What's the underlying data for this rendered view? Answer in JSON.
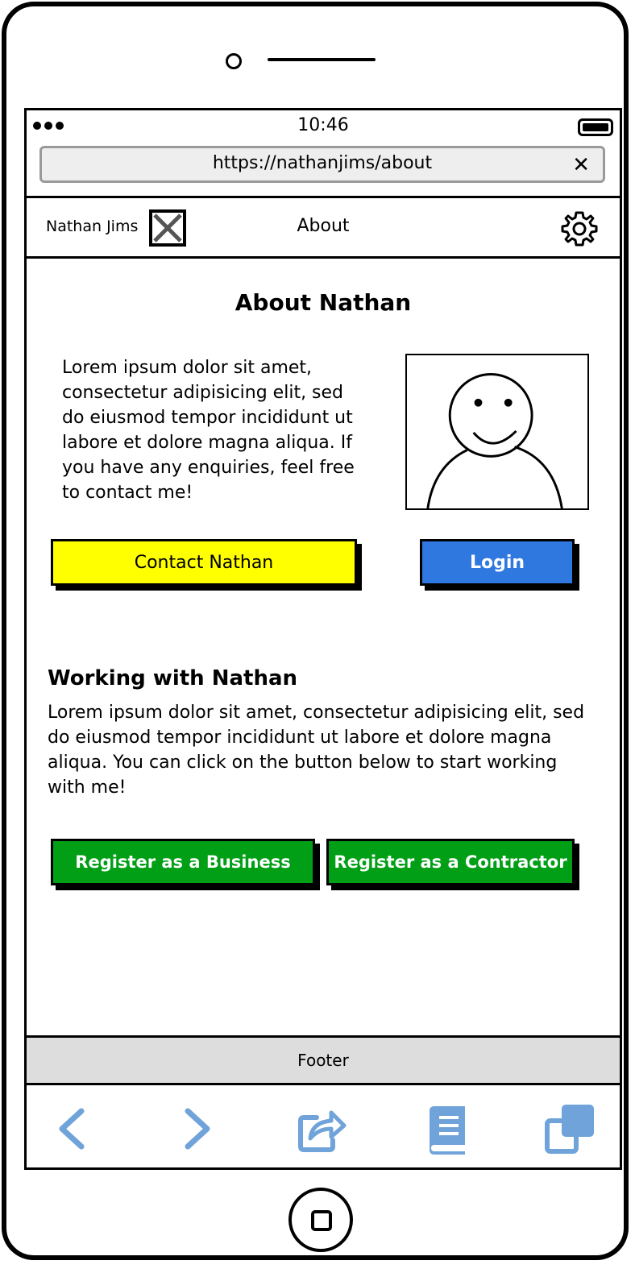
{
  "status_bar": {
    "time": "10:46"
  },
  "browser": {
    "url": "https://nathanjims/about",
    "close_symbol": "✕"
  },
  "header": {
    "brand": "Nathan Jims",
    "title": "About",
    "settings_icon": "gear-icon"
  },
  "about": {
    "title": "About Nathan",
    "text": "Lorem ipsum dolor sit amet, consectetur adipisicing elit, sed do eiusmod tempor incididunt ut labore et dolore magna aliqua. If you have any enquiries, feel free to contact me!",
    "contact_button": "Contact Nathan",
    "login_button": "Login"
  },
  "working": {
    "title": "Working with Nathan",
    "text": "Lorem ipsum dolor sit amet, consectetur adipisicing elit, sed do eiusmod tempor incididunt ut labore et dolore magna aliqua. You can click on the button below to start working with me!",
    "register_business_button": "Register as a Business",
    "register_contractor_button": "Register as a Contractor"
  },
  "footer": {
    "label": "Footer"
  },
  "toolbar": {
    "icons": [
      "back-arrow-icon",
      "forward-arrow-icon",
      "share-icon",
      "bookmarks-icon",
      "tabs-icon"
    ]
  },
  "colors": {
    "contact_button": "#ffff00",
    "login_button": "#2f78e0",
    "register_buttons": "#009f15",
    "toolbar_icons": "#6fa3d9",
    "footer_background": "#dddddd",
    "address_bar_background": "#eeeeee"
  }
}
